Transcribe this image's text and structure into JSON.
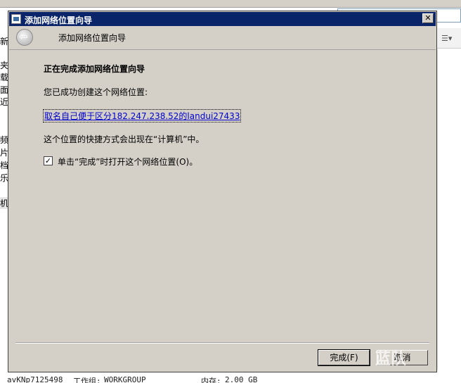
{
  "background": {
    "sidebar_items": [
      {
        "label": "夹"
      },
      {
        "label": "载"
      },
      {
        "label": "面"
      },
      {
        "label": "近访"
      },
      {
        "label": "频"
      },
      {
        "label": "片"
      },
      {
        "label": "档"
      },
      {
        "label": "乐"
      },
      {
        "label": "机"
      }
    ],
    "status_bar": {
      "computer": "avKNp7125498",
      "workgroup_label": "工作组:",
      "workgroup": "WORKGROUP",
      "memory_label": "内存:",
      "memory": "2.00 GB"
    },
    "toolbar_partial": "新"
  },
  "dialog": {
    "window_title": "添加网络位置向导",
    "close_label": "✕",
    "wizard_title": "添加网络位置向导",
    "heading": "正在完成添加网络位置向导",
    "created_text": "您已成功创建这个网络位置:",
    "location_name": "取名自己便于区分182.247.238.52的landui27433",
    "shortcut_text": "这个位置的快捷方式会出现在“计算机”中。",
    "open_checkbox": {
      "checked": true,
      "label": "单击“完成”时打开这个网络位置(O)。"
    },
    "buttons": {
      "finish": "完成(F)",
      "cancel": "取消"
    }
  },
  "watermark": "蓝队"
}
